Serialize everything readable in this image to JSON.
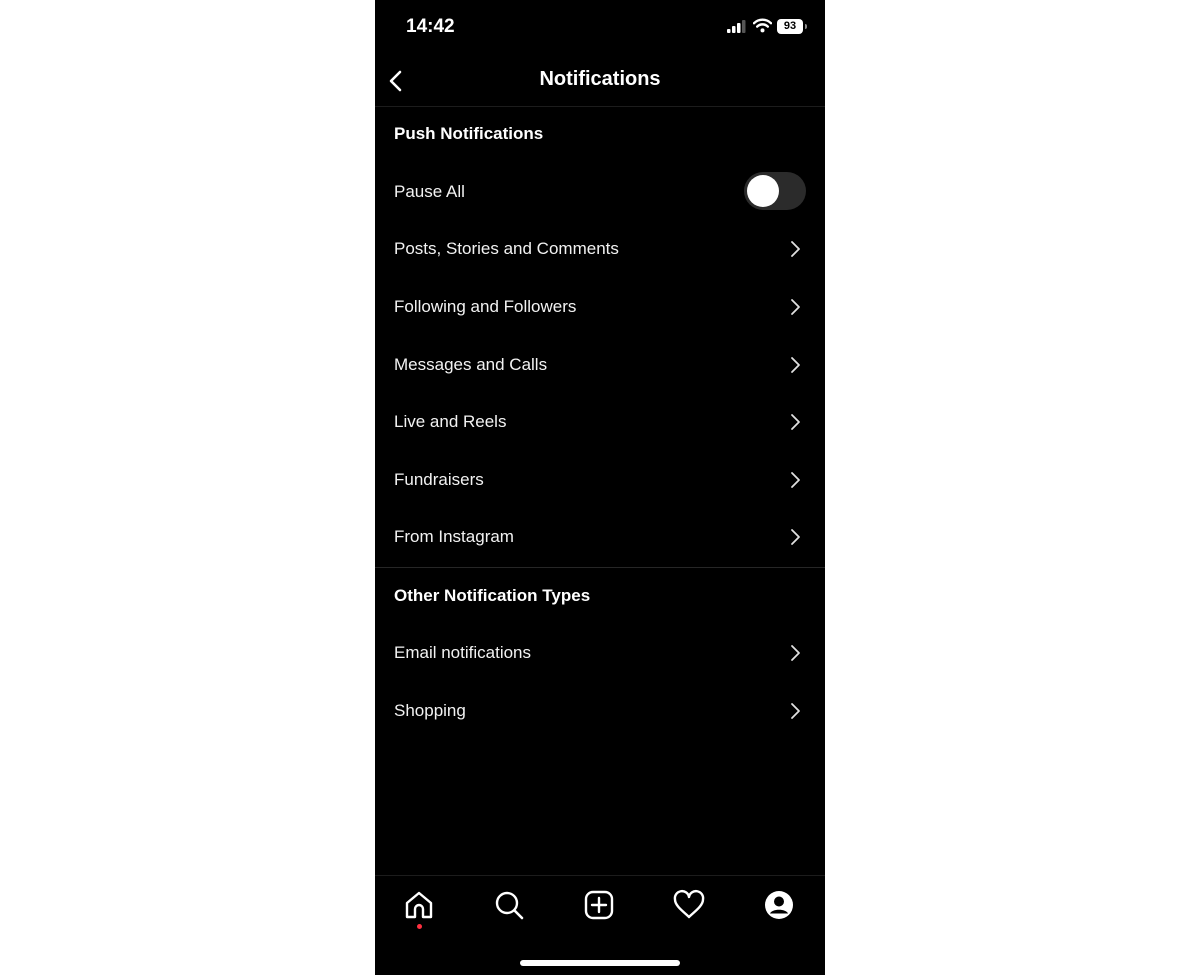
{
  "status_bar": {
    "time": "14:42",
    "battery": "93"
  },
  "header": {
    "title": "Notifications"
  },
  "sections": [
    {
      "title": "Push Notifications",
      "items": [
        {
          "label": "Pause All",
          "type": "toggle",
          "on": false
        },
        {
          "label": "Posts, Stories and Comments",
          "type": "link"
        },
        {
          "label": "Following and Followers",
          "type": "link"
        },
        {
          "label": "Messages and Calls",
          "type": "link"
        },
        {
          "label": "Live and Reels",
          "type": "link"
        },
        {
          "label": "Fundraisers",
          "type": "link"
        },
        {
          "label": "From Instagram",
          "type": "link"
        }
      ]
    },
    {
      "title": "Other Notification Types",
      "items": [
        {
          "label": "Email notifications",
          "type": "link"
        },
        {
          "label": "Shopping",
          "type": "link"
        }
      ]
    }
  ],
  "tab_bar": {
    "tabs": [
      "home-icon",
      "search-icon",
      "create-icon",
      "activity-heart-icon",
      "profile-icon"
    ],
    "active": "home",
    "notification_dot_color": "#ff3040"
  }
}
